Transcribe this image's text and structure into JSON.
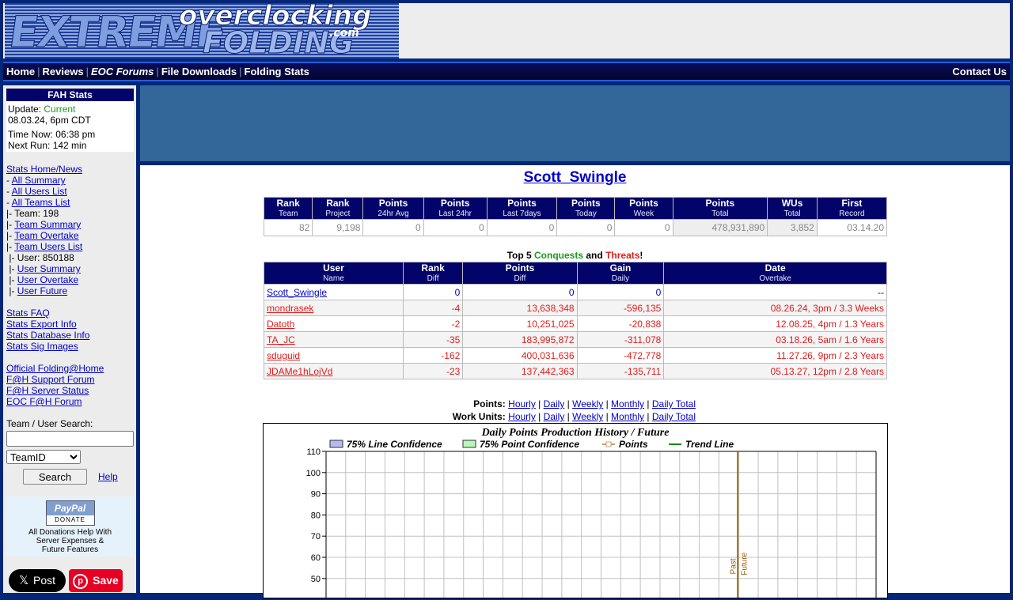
{
  "header": {
    "logo_text": [
      "EXTREME",
      "overclocking",
      "FOLDING",
      ".com"
    ]
  },
  "navbar": {
    "links": [
      "Home",
      "Reviews",
      "EOC Forums",
      "File Downloads",
      "Folding Stats"
    ],
    "separator": "|",
    "contact": "Contact Us"
  },
  "sidebar": {
    "fah_title": "FAH Stats",
    "update_label": "Update:",
    "update_status": "Current",
    "update_status_color": "#1a9a1a",
    "update_time": "08.03.24, 6pm CDT",
    "time_now": "Time Now: 06:38 pm",
    "next_run": "Next Run: 142 min",
    "nav": [
      {
        "prefix": "",
        "label": "Stats Home/News",
        "link": true
      },
      {
        "prefix": "- ",
        "label": "All Summary",
        "link": true
      },
      {
        "prefix": "- ",
        "label": "All Users List",
        "link": true
      },
      {
        "prefix": "- ",
        "label": "All Teams List",
        "link": true
      },
      {
        "prefix": "|- ",
        "label": "Team: 198",
        "link": false
      },
      {
        "prefix": "|- ",
        "label": "Team Summary",
        "link": true
      },
      {
        "prefix": "|- ",
        "label": "Team Overtake",
        "link": true
      },
      {
        "prefix": "|- ",
        "label": "Team Users List",
        "link": true
      },
      {
        "prefix": " |- ",
        "label": "User: 850188",
        "link": false
      },
      {
        "prefix": " |- ",
        "label": "User Summary",
        "link": true
      },
      {
        "prefix": " |- ",
        "label": "User Overtake",
        "link": true
      },
      {
        "prefix": " |- ",
        "label": "User Future",
        "link": true
      },
      {
        "gap": true
      },
      {
        "prefix": "",
        "label": "Stats FAQ",
        "link": true
      },
      {
        "prefix": "",
        "label": "Stats Export Info",
        "link": true
      },
      {
        "prefix": "",
        "label": "Stats Database Info",
        "link": true
      },
      {
        "prefix": "",
        "label": "Stats Sig Images",
        "link": true
      },
      {
        "gap": true
      },
      {
        "prefix": "",
        "label": "Official Folding@Home",
        "link": true
      },
      {
        "prefix": "",
        "label": "F@H Support Forum",
        "link": true
      },
      {
        "prefix": "",
        "label": "F@H Server Status",
        "link": true
      },
      {
        "prefix": "",
        "label": "EOC F@H Forum",
        "link": true
      }
    ],
    "search": {
      "label": "Team / User Search:",
      "value": "",
      "placeholder": "",
      "select_value": "TeamID",
      "button": "Search",
      "help": "Help"
    },
    "donate": {
      "paypal_text": "PayPal",
      "donate_text": "DONATE",
      "message_lines": [
        "All Donations Help With",
        "Server Expenses &",
        "Future Features"
      ]
    },
    "social": {
      "x_post": "Post",
      "pinterest_save": "Save"
    }
  },
  "main": {
    "username": "Scott_Swingle",
    "summary": {
      "headers": [
        {
          "title": "Rank",
          "sub": "Team"
        },
        {
          "title": "Rank",
          "sub": "Project"
        },
        {
          "title": "Points",
          "sub": "24hr Avg"
        },
        {
          "title": "Points",
          "sub": "Last 24hr"
        },
        {
          "title": "Points",
          "sub": "Last 7days"
        },
        {
          "title": "Points",
          "sub": "Today"
        },
        {
          "title": "Points",
          "sub": "Week"
        },
        {
          "title": "Points",
          "sub": "Total"
        },
        {
          "title": "WUs",
          "sub": "Total"
        },
        {
          "title": "First",
          "sub": "Record"
        }
      ],
      "values": [
        "82",
        "9,198",
        "0",
        "0",
        "0",
        "0",
        "0",
        "478,931,890",
        "3,852",
        "03.14.20"
      ]
    },
    "top5": {
      "prefix": "Top 5",
      "conquests": "Conquests",
      "conquests_color": "#1a9a1a",
      "and": "and",
      "threats": "Threats",
      "threats_color": "#e01b1b",
      "suffix": "!",
      "headers": [
        {
          "title": "User",
          "sub": "Name"
        },
        {
          "title": "Rank",
          "sub": "Diff"
        },
        {
          "title": "Points",
          "sub": "Diff"
        },
        {
          "title": "Gain",
          "sub": "Daily"
        },
        {
          "title": "Date",
          "sub": "Overtake"
        }
      ],
      "rows": [
        {
          "name": "Scott_Swingle",
          "rank_diff": "0",
          "points_diff": "0",
          "gain_daily": "0",
          "date": "--",
          "self": true
        },
        {
          "name": "mondrasek",
          "rank_diff": "-4",
          "points_diff": "13,638,348",
          "gain_daily": "-596,135",
          "date": "08.26.24, 3pm / 3.3 Weeks"
        },
        {
          "name": "Datoth",
          "rank_diff": "-2",
          "points_diff": "10,251,025",
          "gain_daily": "-20,838",
          "date": "12.08.25, 4pm / 1.3 Years"
        },
        {
          "name": "TA_JC",
          "rank_diff": "-35",
          "points_diff": "183,995,872",
          "gain_daily": "-311,078",
          "date": "03.18.26, 5am / 1.6 Years"
        },
        {
          "name": "sduguid",
          "rank_diff": "-162",
          "points_diff": "400,031,636",
          "gain_daily": "-472,778",
          "date": "11.27.26, 9pm / 2.3 Years"
        },
        {
          "name": "JDAMe1hLojVd",
          "rank_diff": "-23",
          "points_diff": "137,442,363",
          "gain_daily": "-135,711",
          "date": "05.13.27, 12pm / 2.8 Years"
        }
      ]
    },
    "graph_links": {
      "points_label": "Points:",
      "work_units_label": "Work Units:",
      "links": [
        "Hourly",
        "Daily",
        "Weekly",
        "Monthly",
        "Daily Total"
      ]
    }
  },
  "chart_data": {
    "type": "line",
    "title": "Daily Points Production History / Future",
    "legend": [
      {
        "label": "75% Line Confidence",
        "color": "#b8b8f0",
        "kind": "box"
      },
      {
        "label": "75% Point Confidence",
        "color": "#b8f8b8",
        "kind": "box"
      },
      {
        "label": "Points",
        "color": "#c8a070",
        "kind": "line-marker"
      },
      {
        "label": "Trend Line",
        "color": "#138a13",
        "kind": "line"
      }
    ],
    "legend_position": "top",
    "yticks": [
      110,
      100,
      90,
      80,
      70,
      60,
      50
    ],
    "ylim_visible": [
      50,
      110
    ],
    "grid": true,
    "x_columns": 28,
    "divider_column": 21,
    "divider_color": "#a0600a",
    "divider_labels": [
      "Past",
      "Future"
    ],
    "series": []
  }
}
